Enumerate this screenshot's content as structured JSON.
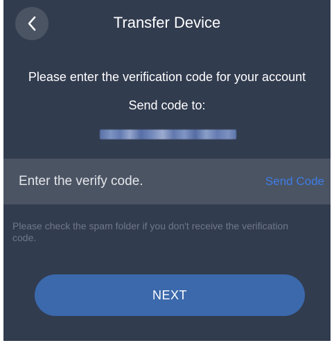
{
  "header": {
    "back_icon": "chevron-left-icon",
    "title": "Transfer Device"
  },
  "verification": {
    "prompt": "Please enter the verification code for your account",
    "send_to_label": "Send code to:"
  },
  "code_field": {
    "placeholder": "Enter the verify code.",
    "send_code_label": "Send Code"
  },
  "hint": "Please check the spam folder if you don't receive the verification code.",
  "next_label": "NEXT",
  "colors": {
    "background": "#323c4f",
    "field_background": "#4b5463",
    "accent_link": "#3d7de6",
    "button": "#3b69ac",
    "hint_text": "#6f798a"
  }
}
